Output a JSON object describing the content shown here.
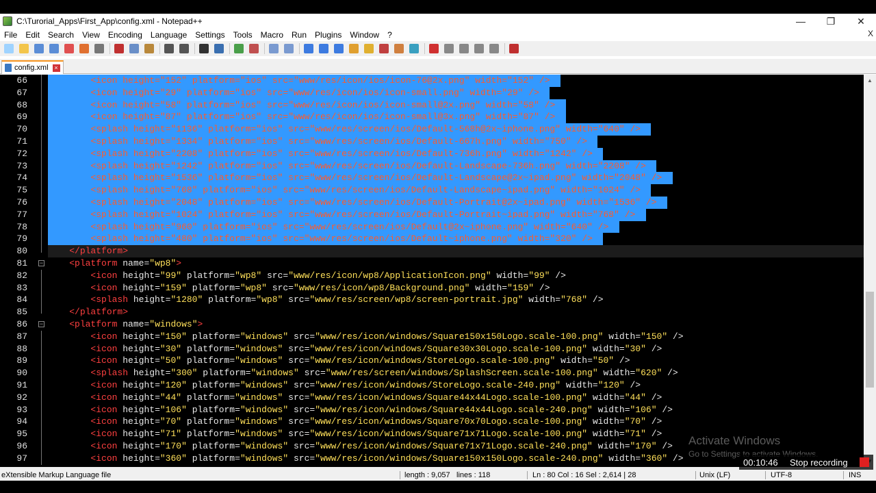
{
  "window": {
    "title": "C:\\Turorial_Apps\\First_App\\config.xml - Notepad++",
    "controls": [
      "—",
      "❐",
      "✕"
    ]
  },
  "menu": {
    "items": [
      "File",
      "Edit",
      "Search",
      "View",
      "Encoding",
      "Language",
      "Settings",
      "Tools",
      "Macro",
      "Run",
      "Plugins",
      "Window",
      "?"
    ],
    "close_glyph": "X"
  },
  "toolbar": {
    "buttons": [
      {
        "icon": "new-file-icon",
        "color": "#9fd3ff"
      },
      {
        "icon": "open-file-icon",
        "color": "#f3c54b"
      },
      {
        "icon": "save-icon",
        "color": "#5b8dd6"
      },
      {
        "icon": "save-all-icon",
        "color": "#5b8dd6"
      },
      {
        "icon": "close-file-icon",
        "color": "#e05050"
      },
      {
        "icon": "close-all-icon",
        "color": "#e07030"
      },
      {
        "icon": "print-icon",
        "color": "#777777"
      },
      {
        "sep": true
      },
      {
        "icon": "cut-icon",
        "color": "#c03030"
      },
      {
        "icon": "copy-icon",
        "color": "#6a8fc8"
      },
      {
        "icon": "paste-icon",
        "color": "#b9883b"
      },
      {
        "sep": true
      },
      {
        "icon": "undo-icon",
        "color": "#555555"
      },
      {
        "icon": "redo-icon",
        "color": "#555555"
      },
      {
        "sep": true
      },
      {
        "icon": "find-icon",
        "color": "#333333"
      },
      {
        "icon": "replace-icon",
        "color": "#3a6fb0"
      },
      {
        "sep": true
      },
      {
        "icon": "zoom-in-icon",
        "color": "#4a9f4a"
      },
      {
        "icon": "zoom-out-icon",
        "color": "#c05050"
      },
      {
        "sep": true
      },
      {
        "icon": "sync-vertical-icon",
        "color": "#7a9ad0"
      },
      {
        "icon": "sync-horizontal-icon",
        "color": "#7a9ad0"
      },
      {
        "sep": true
      },
      {
        "icon": "word-wrap-icon",
        "color": "#3d7be0"
      },
      {
        "icon": "show-all-chars-icon",
        "color": "#3d7be0"
      },
      {
        "icon": "indent-guide-icon",
        "color": "#3d7be0"
      },
      {
        "icon": "udl-icon",
        "color": "#e0a030"
      },
      {
        "icon": "doc-map-icon",
        "color": "#e0b030"
      },
      {
        "icon": "function-list-icon",
        "color": "#c04040"
      },
      {
        "icon": "folder-workspace-icon",
        "color": "#d08040"
      },
      {
        "icon": "monitoring-icon",
        "color": "#3aa0c0"
      },
      {
        "sep": true
      },
      {
        "icon": "record-macro-icon",
        "color": "#d03030"
      },
      {
        "icon": "stop-macro-icon",
        "color": "#888888"
      },
      {
        "icon": "play-macro-icon",
        "color": "#888888"
      },
      {
        "icon": "play-multiple-icon",
        "color": "#888888"
      },
      {
        "icon": "save-macro-icon",
        "color": "#888888"
      },
      {
        "sep": true
      },
      {
        "icon": "spellcheck-icon",
        "color": "#c03030"
      }
    ]
  },
  "tab": {
    "label": "config.xml",
    "close": "×"
  },
  "editor": {
    "selected_lines": [
      66,
      79
    ],
    "current_line": 80,
    "lines": [
      {
        "n": "66",
        "fold": "line",
        "indent": 8,
        "tag": "<icon",
        "attrs": [
          [
            "height",
            "\"152\""
          ],
          [
            "platform",
            "\"ios\""
          ],
          [
            "src",
            "\"www/res/icon/ios/icon-76@2x.png\""
          ],
          [
            "width",
            "\"152\""
          ]
        ],
        "close": " />"
      },
      {
        "n": "67",
        "fold": "line",
        "indent": 8,
        "tag": "<icon",
        "attrs": [
          [
            "height",
            "\"29\""
          ],
          [
            "platform",
            "\"ios\""
          ],
          [
            "src",
            "\"www/res/icon/ios/icon-small.png\""
          ],
          [
            "width",
            "\"29\""
          ]
        ],
        "close": " />"
      },
      {
        "n": "68",
        "fold": "line",
        "indent": 8,
        "tag": "<icon",
        "attrs": [
          [
            "height",
            "\"58\""
          ],
          [
            "platform",
            "\"ios\""
          ],
          [
            "src",
            "\"www/res/icon/ios/icon-small@2x.png\""
          ],
          [
            "width",
            "\"58\""
          ]
        ],
        "close": " />"
      },
      {
        "n": "69",
        "fold": "line",
        "indent": 8,
        "tag": "<icon",
        "attrs": [
          [
            "height",
            "\"87\""
          ],
          [
            "platform",
            "\"ios\""
          ],
          [
            "src",
            "\"www/res/icon/ios/icon-small@3x.png\""
          ],
          [
            "width",
            "\"87\""
          ]
        ],
        "close": " />"
      },
      {
        "n": "70",
        "fold": "line",
        "indent": 8,
        "tag": "<splash",
        "attrs": [
          [
            "height",
            "\"1136\""
          ],
          [
            "platform",
            "\"ios\""
          ],
          [
            "src",
            "\"www/res/screen/ios/Default-568h@2x~iphone.png\""
          ],
          [
            "width",
            "\"640\""
          ]
        ],
        "close": " />"
      },
      {
        "n": "71",
        "fold": "line",
        "indent": 8,
        "tag": "<splash",
        "attrs": [
          [
            "height",
            "\"1334\""
          ],
          [
            "platform",
            "\"ios\""
          ],
          [
            "src",
            "\"www/res/screen/ios/Default-667h.png\""
          ],
          [
            "width",
            "\"750\""
          ]
        ],
        "close": " />"
      },
      {
        "n": "72",
        "fold": "line",
        "indent": 8,
        "tag": "<splash",
        "attrs": [
          [
            "height",
            "\"2208\""
          ],
          [
            "platform",
            "\"ios\""
          ],
          [
            "src",
            "\"www/res/screen/ios/Default-736h.png\""
          ],
          [
            "width",
            "\"1242\""
          ]
        ],
        "close": " />"
      },
      {
        "n": "73",
        "fold": "line",
        "indent": 8,
        "tag": "<splash",
        "attrs": [
          [
            "height",
            "\"1242\""
          ],
          [
            "platform",
            "\"ios\""
          ],
          [
            "src",
            "\"www/res/screen/ios/Default-Landscape-736h.png\""
          ],
          [
            "width",
            "\"2208\""
          ]
        ],
        "close": " />"
      },
      {
        "n": "74",
        "fold": "line",
        "indent": 8,
        "tag": "<splash",
        "attrs": [
          [
            "height",
            "\"1536\""
          ],
          [
            "platform",
            "\"ios\""
          ],
          [
            "src",
            "\"www/res/screen/ios/Default-Landscape@2x~ipad.png\""
          ],
          [
            "width",
            "\"2048\""
          ]
        ],
        "close": " />"
      },
      {
        "n": "75",
        "fold": "line",
        "indent": 8,
        "tag": "<splash",
        "attrs": [
          [
            "height",
            "\"768\""
          ],
          [
            "platform",
            "\"ios\""
          ],
          [
            "src",
            "\"www/res/screen/ios/Default-Landscape~ipad.png\""
          ],
          [
            "width",
            "\"1024\""
          ]
        ],
        "close": " />"
      },
      {
        "n": "76",
        "fold": "line",
        "indent": 8,
        "tag": "<splash",
        "attrs": [
          [
            "height",
            "\"2048\""
          ],
          [
            "platform",
            "\"ios\""
          ],
          [
            "src",
            "\"www/res/screen/ios/Default-Portrait@2x~ipad.png\""
          ],
          [
            "width",
            "\"1536\""
          ]
        ],
        "close": " />"
      },
      {
        "n": "77",
        "fold": "line",
        "indent": 8,
        "tag": "<splash",
        "attrs": [
          [
            "height",
            "\"1024\""
          ],
          [
            "platform",
            "\"ios\""
          ],
          [
            "src",
            "\"www/res/screen/ios/Default-Portrait~ipad.png\""
          ],
          [
            "width",
            "\"768\""
          ]
        ],
        "close": " />"
      },
      {
        "n": "78",
        "fold": "line",
        "indent": 8,
        "tag": "<splash",
        "attrs": [
          [
            "height",
            "\"960\""
          ],
          [
            "platform",
            "\"ios\""
          ],
          [
            "src",
            "\"www/res/screen/ios/Default@2x~iphone.png\""
          ],
          [
            "width",
            "\"640\""
          ]
        ],
        "close": " />"
      },
      {
        "n": "79",
        "fold": "line",
        "indent": 8,
        "tag": "<splash",
        "attrs": [
          [
            "height",
            "\"480\""
          ],
          [
            "platform",
            "\"ios\""
          ],
          [
            "src",
            "\"www/res/screen/ios/Default~iphone.png\""
          ],
          [
            "width",
            "\"320\""
          ]
        ],
        "close": " />"
      },
      {
        "n": "80",
        "fold": "end",
        "indent": 4,
        "tag": "</platform>",
        "attrs": [],
        "close": ""
      },
      {
        "n": "81",
        "fold": "open",
        "indent": 4,
        "tag": "<platform",
        "attrs": [
          [
            "name",
            "\"wp8\""
          ]
        ],
        "close": ">"
      },
      {
        "n": "82",
        "fold": "line",
        "indent": 8,
        "tag": "<icon",
        "attrs": [
          [
            "height",
            "\"99\""
          ],
          [
            "platform",
            "\"wp8\""
          ],
          [
            "src",
            "\"www/res/icon/wp8/ApplicationIcon.png\""
          ],
          [
            "width",
            "\"99\""
          ]
        ],
        "close": " />"
      },
      {
        "n": "83",
        "fold": "line",
        "indent": 8,
        "tag": "<icon",
        "attrs": [
          [
            "height",
            "\"159\""
          ],
          [
            "platform",
            "\"wp8\""
          ],
          [
            "src",
            "\"www/res/icon/wp8/Background.png\""
          ],
          [
            "width",
            "\"159\""
          ]
        ],
        "close": " />"
      },
      {
        "n": "84",
        "fold": "line",
        "indent": 8,
        "tag": "<splash",
        "attrs": [
          [
            "height",
            "\"1280\""
          ],
          [
            "platform",
            "\"wp8\""
          ],
          [
            "src",
            "\"www/res/screen/wp8/screen-portrait.jpg\""
          ],
          [
            "width",
            "\"768\""
          ]
        ],
        "close": " />"
      },
      {
        "n": "85",
        "fold": "end",
        "indent": 4,
        "tag": "</platform>",
        "attrs": [],
        "close": ""
      },
      {
        "n": "86",
        "fold": "open",
        "indent": 4,
        "tag": "<platform",
        "attrs": [
          [
            "name",
            "\"windows\""
          ]
        ],
        "close": ">"
      },
      {
        "n": "87",
        "fold": "line",
        "indent": 8,
        "tag": "<icon",
        "attrs": [
          [
            "height",
            "\"150\""
          ],
          [
            "platform",
            "\"windows\""
          ],
          [
            "src",
            "\"www/res/icon/windows/Square150x150Logo.scale-100.png\""
          ],
          [
            "width",
            "\"150\""
          ]
        ],
        "close": " />"
      },
      {
        "n": "88",
        "fold": "line",
        "indent": 8,
        "tag": "<icon",
        "attrs": [
          [
            "height",
            "\"30\""
          ],
          [
            "platform",
            "\"windows\""
          ],
          [
            "src",
            "\"www/res/icon/windows/Square30x30Logo.scale-100.png\""
          ],
          [
            "width",
            "\"30\""
          ]
        ],
        "close": " />"
      },
      {
        "n": "89",
        "fold": "line",
        "indent": 8,
        "tag": "<icon",
        "attrs": [
          [
            "height",
            "\"50\""
          ],
          [
            "platform",
            "\"windows\""
          ],
          [
            "src",
            "\"www/res/icon/windows/StoreLogo.scale-100.png\""
          ],
          [
            "width",
            "\"50\""
          ]
        ],
        "close": " />"
      },
      {
        "n": "90",
        "fold": "line",
        "indent": 8,
        "tag": "<splash",
        "attrs": [
          [
            "height",
            "\"300\""
          ],
          [
            "platform",
            "\"windows\""
          ],
          [
            "src",
            "\"www/res/screen/windows/SplashScreen.scale-100.png\""
          ],
          [
            "width",
            "\"620\""
          ]
        ],
        "close": " />"
      },
      {
        "n": "91",
        "fold": "line",
        "indent": 8,
        "tag": "<icon",
        "attrs": [
          [
            "height",
            "\"120\""
          ],
          [
            "platform",
            "\"windows\""
          ],
          [
            "src",
            "\"www/res/icon/windows/StoreLogo.scale-240.png\""
          ],
          [
            "width",
            "\"120\""
          ]
        ],
        "close": " />"
      },
      {
        "n": "92",
        "fold": "line",
        "indent": 8,
        "tag": "<icon",
        "attrs": [
          [
            "height",
            "\"44\""
          ],
          [
            "platform",
            "\"windows\""
          ],
          [
            "src",
            "\"www/res/icon/windows/Square44x44Logo.scale-100.png\""
          ],
          [
            "width",
            "\"44\""
          ]
        ],
        "close": " />"
      },
      {
        "n": "93",
        "fold": "line",
        "indent": 8,
        "tag": "<icon",
        "attrs": [
          [
            "height",
            "\"106\""
          ],
          [
            "platform",
            "\"windows\""
          ],
          [
            "src",
            "\"www/res/icon/windows/Square44x44Logo.scale-240.png\""
          ],
          [
            "width",
            "\"106\""
          ]
        ],
        "close": " />"
      },
      {
        "n": "94",
        "fold": "line",
        "indent": 8,
        "tag": "<icon",
        "attrs": [
          [
            "height",
            "\"70\""
          ],
          [
            "platform",
            "\"windows\""
          ],
          [
            "src",
            "\"www/res/icon/windows/Square70x70Logo.scale-100.png\""
          ],
          [
            "width",
            "\"70\""
          ]
        ],
        "close": " />"
      },
      {
        "n": "95",
        "fold": "line",
        "indent": 8,
        "tag": "<icon",
        "attrs": [
          [
            "height",
            "\"71\""
          ],
          [
            "platform",
            "\"windows\""
          ],
          [
            "src",
            "\"www/res/icon/windows/Square71x71Logo.scale-100.png\""
          ],
          [
            "width",
            "\"71\""
          ]
        ],
        "close": " />"
      },
      {
        "n": "96",
        "fold": "line",
        "indent": 8,
        "tag": "<icon",
        "attrs": [
          [
            "height",
            "\"170\""
          ],
          [
            "platform",
            "\"windows\""
          ],
          [
            "src",
            "\"www/res/icon/windows/Square71x71Logo.scale-240.png\""
          ],
          [
            "width",
            "\"170\""
          ]
        ],
        "close": " />"
      },
      {
        "n": "97",
        "fold": "line",
        "indent": 8,
        "tag": "<icon",
        "attrs": [
          [
            "height",
            "\"360\""
          ],
          [
            "platform",
            "\"windows\""
          ],
          [
            "src",
            "\"www/res/icon/windows/Square150x150Logo.scale-240.png\""
          ],
          [
            "width",
            "\"360\""
          ]
        ],
        "close": " />"
      }
    ]
  },
  "statusbar": {
    "file_type": "eXtensible Markup Language file",
    "length": "length : 9,057",
    "lines": "lines : 118",
    "position": "Ln : 80    Col : 16    Sel : 2,614 | 28",
    "eol": "Unix (LF)",
    "encoding": "UTF-8",
    "mode": "INS"
  },
  "overlay": {
    "activate_title": "Activate Windows",
    "activate_sub": "Go to Settings to activate Windows.",
    "rec_time": "00:10:46",
    "rec_label": "Stop recording"
  },
  "colors": {
    "selection": "#3399ff",
    "tag": "#ff4040",
    "value": "#ffe05a",
    "tab_accent": "#f7931e"
  }
}
